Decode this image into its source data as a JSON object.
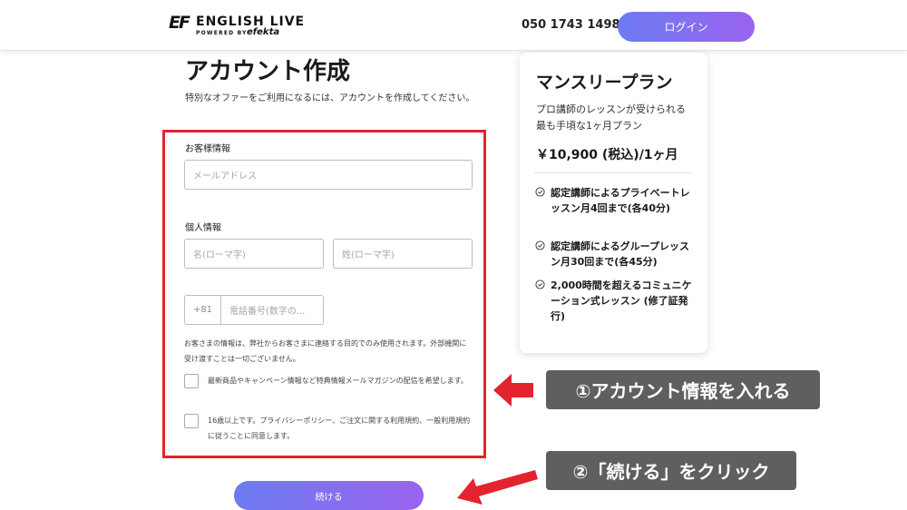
{
  "header": {
    "logo": {
      "mark": "EF",
      "name": "ENGLISH LIVE",
      "powered_by": "POWERED BY",
      "brand": "efekta"
    },
    "phone": "050 1743 1498",
    "login_label": "ログイン"
  },
  "main": {
    "title": "アカウント作成",
    "subtitle": "特別なオファーをご利用になるには、アカウントを作成してください。",
    "form": {
      "customer_info_label": "お客様情報",
      "email_placeholder": "メールアドレス",
      "personal_info_label": "個人情報",
      "first_name_placeholder": "名(ローマ字)",
      "last_name_placeholder": "姓(ローマ字)",
      "country_code": "+81",
      "phone_placeholder": "電話番号(数字の...",
      "notice": "お客さまの情報は、弊社からお客さまに連絡する目的でのみ使用されます。外部機関に受け渡すことは一切ございません。",
      "checkbox_newsletter": "最新商品やキャンペーン情報など特典情報メールマガジンの配信を希望します。",
      "checkbox_terms": "16歳以上です。プライバシーポリシー、ご注文に関する利用規約、一般利用規約に従うことに同意します。"
    },
    "continue_label": "続ける"
  },
  "plan": {
    "title": "マンスリープラン",
    "description": "プロ講師のレッスンが受けられる最も手頃な1ヶ月プラン",
    "price": "￥10,900 (税込)/1ヶ月",
    "features": [
      "認定講師によるプライベートレッスン月4回まで(各40分)",
      "認定講師によるグループレッスン月30回まで(各45分)",
      "2,000時間を超えるコミュニケーション式レッスン (修了証発行)"
    ]
  },
  "annotations": {
    "step1": "①アカウント情報を入れる",
    "step2": "②「続ける」をクリック"
  },
  "colors": {
    "button_gradient_start": "#6d7cf2",
    "button_gradient_end": "#9a63ee",
    "highlight_red": "#e3232e",
    "annotation_bg": "#5f5f5f"
  },
  "icons": {
    "feature": "check-circle-icon",
    "arrow": "arrow-left-icon"
  }
}
